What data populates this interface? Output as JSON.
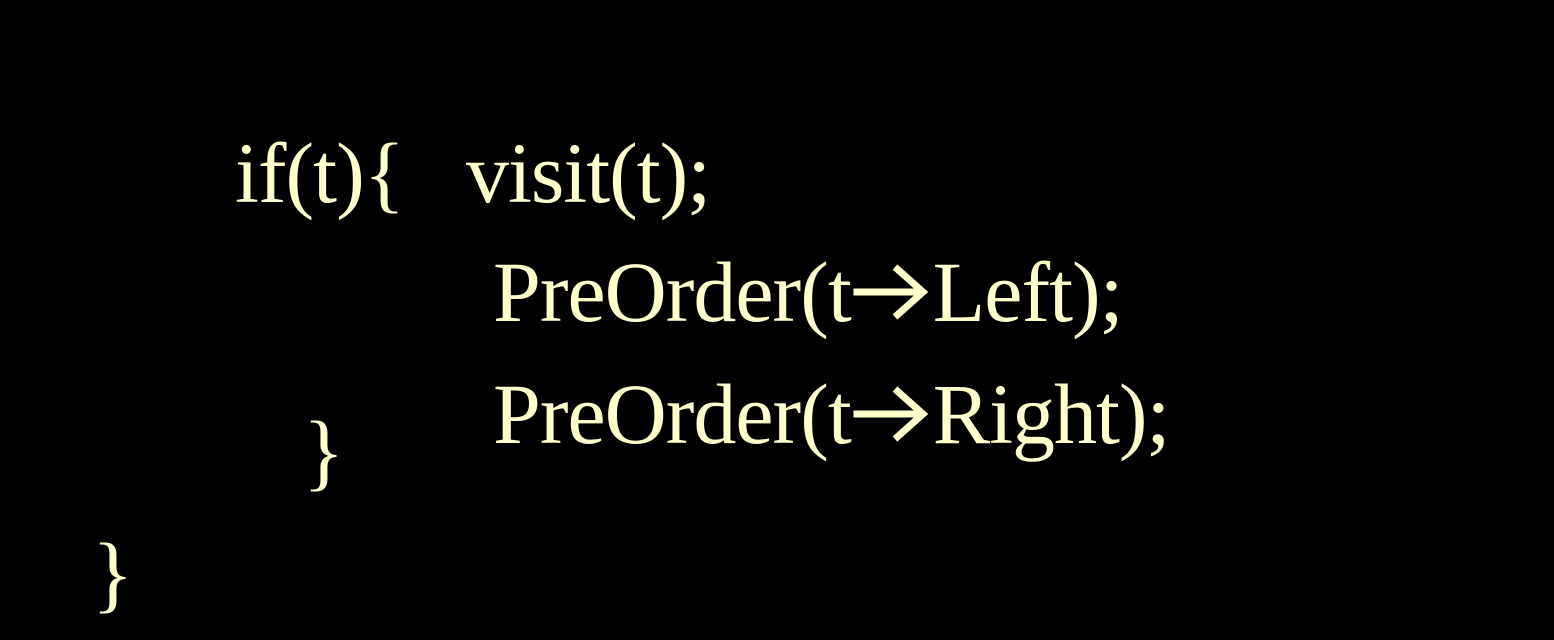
{
  "code": {
    "if_keyword": "if(t){",
    "visit_stmt": "visit(t);",
    "preorder_left_prefix": "PreOrder(t",
    "preorder_left_suffix": "Left);",
    "preorder_right_prefix": "PreOrder(t",
    "preorder_right_suffix": "Right);",
    "inner_close_brace": "}",
    "outer_close_brace": "}"
  },
  "icons": {
    "pointer_arrow": "right-arrow-icon"
  },
  "colors": {
    "background": "#000000",
    "text": "#FFFFCC"
  }
}
